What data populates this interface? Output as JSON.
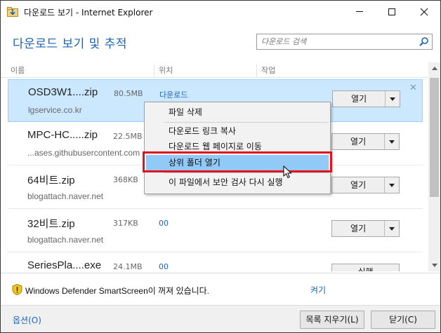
{
  "window": {
    "title": "다운로드 보기 - Internet Explorer"
  },
  "header": {
    "title": "다운로드 보기 및 추적",
    "search_placeholder": "다운로드 검색"
  },
  "columns": {
    "name": "이름",
    "location": "위치",
    "action": "작업"
  },
  "downloads": [
    {
      "name": "OSD3W1....zip",
      "size": "80.5MB",
      "source": "lgservice.co.kr",
      "location": "다운로드",
      "action": "열기"
    },
    {
      "name": "MPC-HC.....zip",
      "size": "22.5MB",
      "source": "...ases.githubusercontent.com",
      "location": "",
      "action": "열기"
    },
    {
      "name": "64비트.zip",
      "size": "368KB",
      "source": "blogattach.naver.net",
      "location": "",
      "action": "열기"
    },
    {
      "name": "32비트.zip",
      "size": "317KB",
      "source": "blogattach.naver.net",
      "location": "00",
      "action": "열기"
    },
    {
      "name": "SeriesPla....exe",
      "size": "24.1MB",
      "source": "",
      "location": "00",
      "action": "실행"
    }
  ],
  "context_menu": {
    "items": [
      "파일 삭제",
      "다운로드 링크 복사",
      "다운로드 웹 페이지로 이동",
      "상위 폴더 열기",
      "이 파일에서 보안 검사 다시 실행"
    ],
    "highlighted_index": 3
  },
  "notification": {
    "text": "Windows Defender SmartScreen이 꺼져 있습니다.",
    "link": "켜기"
  },
  "footer": {
    "options": "옵션(O)",
    "clear_list": "목록 지우기(L)",
    "close": "닫기(C)"
  },
  "colors": {
    "accent": "#1c63b8",
    "selected_row": "#cce8ff",
    "menu_highlight": "#91c9f7",
    "annotation_box": "#e0141c"
  }
}
